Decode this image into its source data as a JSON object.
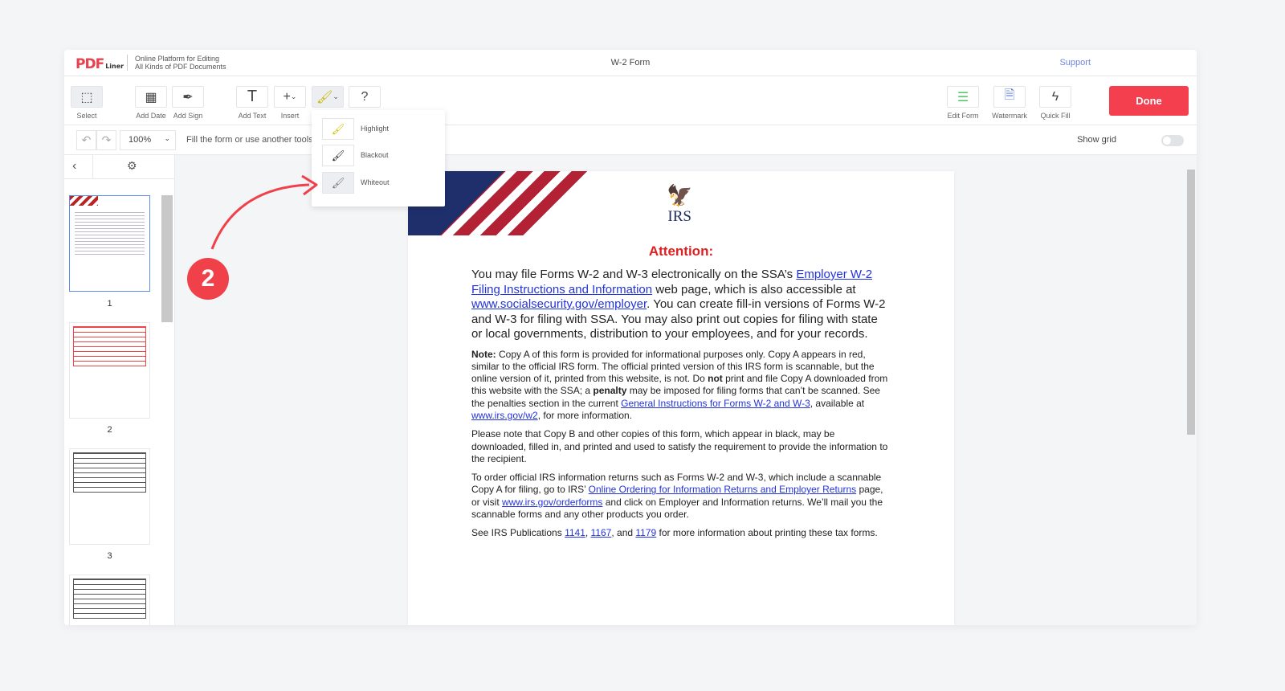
{
  "header": {
    "logo": "PDF",
    "logo_suffix": "Liner",
    "tagline_1": "Online Platform for Editing",
    "tagline_2": "All Kinds of PDF Documents",
    "title": "W-2 Form",
    "support": "Support"
  },
  "toolbar": {
    "select": "Select",
    "add_date": "Add Date",
    "add_sign": "Add Sign",
    "add_text": "Add Text",
    "insert": "Insert",
    "help": "?",
    "edit_form": "Edit Form",
    "watermark": "Watermark",
    "quick_fill": "Quick Fill",
    "done": "Done"
  },
  "subbar": {
    "zoom": "100%",
    "hint": "Fill the form or use another tools",
    "show_grid": "Show grid",
    "show_grid_on": false
  },
  "brush_menu": {
    "items": [
      {
        "label": "Highlight",
        "color": "#e8d21a"
      },
      {
        "label": "Blackout",
        "color": "#222222"
      },
      {
        "label": "Whiteout",
        "color": "#ffffff",
        "hovered": true
      }
    ]
  },
  "sidebar": {
    "pages": [
      "1",
      "2",
      "3"
    ],
    "selected": "1"
  },
  "annotation": {
    "step": "2",
    "color": "#f0404a"
  },
  "document": {
    "irs": "IRS",
    "attention": "Attention:",
    "paragraphs": [
      {
        "cls": "lead",
        "segs": [
          {
            "t": "You may file Forms W-2 and W-3 electronically on the SSA’s "
          },
          {
            "t": "Employer W-2 Filing Instructions and Information",
            "link": true
          },
          {
            "t": " web page, which is also accessible at "
          },
          {
            "t": "www.socialsecurity.gov/employer",
            "link": true
          },
          {
            "t": ".  You can create fill-in versions of Forms W-2 and W-3 for filing with SSA. You may also print out copies for filing with state or local governments, distribution to your employees, and for your records."
          }
        ]
      },
      {
        "cls": "p",
        "segs": [
          {
            "t": "Note:",
            "bold": true
          },
          {
            "t": " Copy A of this form is provided for informational purposes only. Copy A appears in red, similar to the official IRS form. The official printed version of this IRS form is scannable, but the online version of it, printed from this website, is not. Do "
          },
          {
            "t": "not",
            "bold": true
          },
          {
            "t": " print and file Copy A downloaded from this website with the SSA; a "
          },
          {
            "t": "penalty",
            "bold": true
          },
          {
            "t": " may be imposed for filing forms that can’t be scanned. See the penalties section in the current "
          },
          {
            "t": "General Instructions for Forms W-2 and W-3",
            "link": true
          },
          {
            "t": ", available at "
          },
          {
            "t": "www.irs.gov/w2",
            "link": true
          },
          {
            "t": ", for more information."
          }
        ]
      },
      {
        "cls": "p",
        "segs": [
          {
            "t": "Please note that Copy B and other copies of this form, which appear in black, may be downloaded, filled in, and printed and used to satisfy the requirement to provide the information to the recipient."
          }
        ]
      },
      {
        "cls": "p",
        "segs": [
          {
            "t": "To order official IRS information returns such as Forms W-2 and W-3, which include a scannable Copy A for filing, go to IRS’ "
          },
          {
            "t": "Online Ordering for Information Returns and Employer Returns",
            "link": true
          },
          {
            "t": " page, or visit "
          },
          {
            "t": "www.irs.gov/orderforms",
            "link": true
          },
          {
            "t": " and click on Employer and Information returns. We’ll mail you the scannable forms and any other products you order."
          }
        ]
      },
      {
        "cls": "p",
        "segs": [
          {
            "t": "See IRS Publications "
          },
          {
            "t": "1141",
            "link": true
          },
          {
            "t": ", "
          },
          {
            "t": "1167",
            "link": true
          },
          {
            "t": ", and "
          },
          {
            "t": "1179",
            "link": true
          },
          {
            "t": " for more information about printing these tax forms."
          }
        ]
      }
    ]
  }
}
